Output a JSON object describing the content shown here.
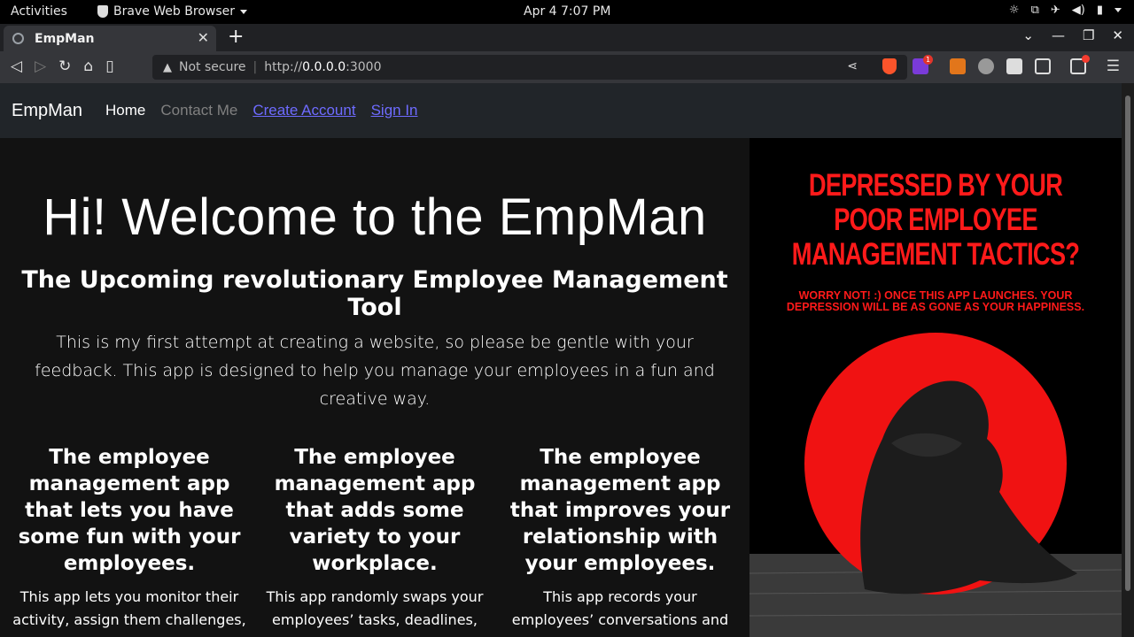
{
  "system": {
    "activities": "Activities",
    "app_name": "Brave Web Browser",
    "clock": "Apr 4   7:07 PM"
  },
  "browser": {
    "tab_title": "EmpMan",
    "security_label": "Not secure",
    "url_prefix": "http://",
    "url_host": "0.0.0.0",
    "url_port": ":3000",
    "rewards_badge": "1"
  },
  "site": {
    "brand": "EmpMan",
    "nav": [
      {
        "label": "Home"
      },
      {
        "label": "Contact Me"
      },
      {
        "label": "Create Account"
      },
      {
        "label": "Sign In"
      }
    ],
    "hero": {
      "title": "Hi! Welcome to the EmpMan",
      "subtitle": "The Upcoming revolutionary Employee Management Tool",
      "lead": "This is my first attempt at creating a website, so please be gentle with your feedback. This app is designed to help you manage your employees in a fun and creative way."
    },
    "features": [
      {
        "heading": "The employee management app that lets you have some fun with your employees.",
        "text": "This app lets you monitor their activity, assign them challenges,"
      },
      {
        "heading": "The employee management app that adds some variety to your workplace.",
        "text": "This app randomly swaps your employees’ tasks, deadlines,"
      },
      {
        "heading": "The employee management app that improves your relationship with your employees.",
        "text": "This app records your employees’ conversations and"
      }
    ],
    "poster": {
      "headline": "DEPRESSED BY YOUR POOR EMPLOYEE MANAGEMENT TACTICS?",
      "subtext": "WORRY NOT! :) ONCE THIS APP LAUNCHES. YOUR DEPRESSION WILL BE AS GONE AS YOUR HAPPINESS."
    }
  },
  "colors": {
    "navbar_bg": "#212529",
    "page_bg": "#121212",
    "link": "#6e6bff",
    "poster_red": "#ff1a1a"
  }
}
